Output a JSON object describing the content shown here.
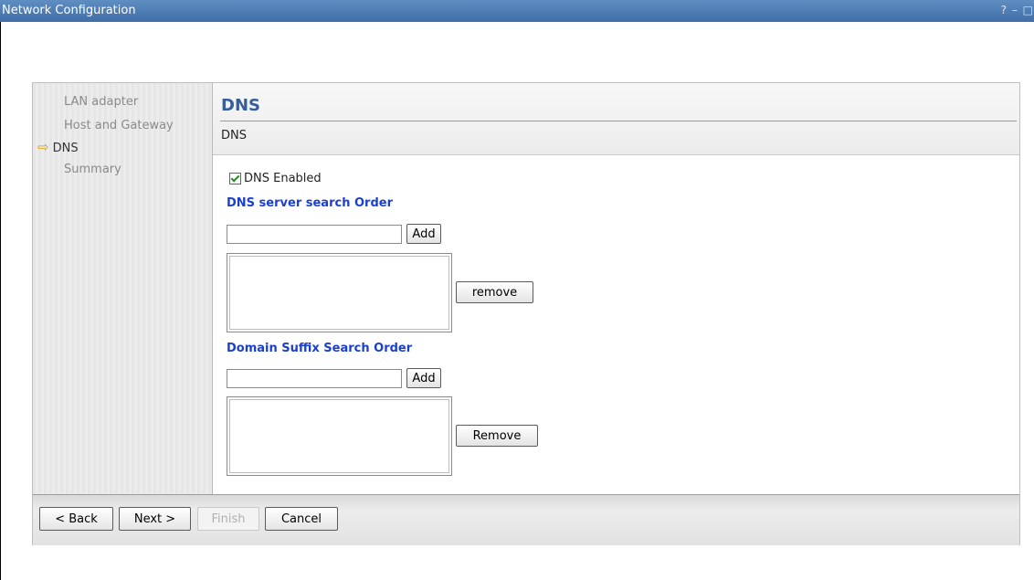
{
  "window": {
    "title": "Network Configuration",
    "controls": "? – □"
  },
  "steps": [
    {
      "label": "LAN adapter",
      "current": false
    },
    {
      "label": "Host and Gateway",
      "current": false
    },
    {
      "label": "DNS",
      "current": true
    },
    {
      "label": "Summary",
      "current": false
    }
  ],
  "header": {
    "title": "DNS",
    "subtitle": "DNS"
  },
  "dns_enabled": {
    "label": "DNS Enabled",
    "checked": true
  },
  "dns_server": {
    "section_label": "DNS server search Order",
    "input_value": "",
    "add_label": "Add",
    "remove_label": "remove",
    "entries": []
  },
  "domain_suffix": {
    "section_label": "Domain Suffix Search Order",
    "input_value": "",
    "add_label": "Add",
    "remove_label": "Remove",
    "entries": []
  },
  "footer": {
    "back_label": "< Back",
    "next_label": "Next >",
    "finish_label": "Finish",
    "cancel_label": "Cancel"
  },
  "colors": {
    "titlebar": "#4a7ab5",
    "heading": "#355f9b",
    "section_label": "#1b3fcf",
    "current_step_arrow": "#e0a000"
  },
  "icons": {
    "current_step": "arrow-right-icon",
    "checkbox": "checkmark-icon"
  }
}
